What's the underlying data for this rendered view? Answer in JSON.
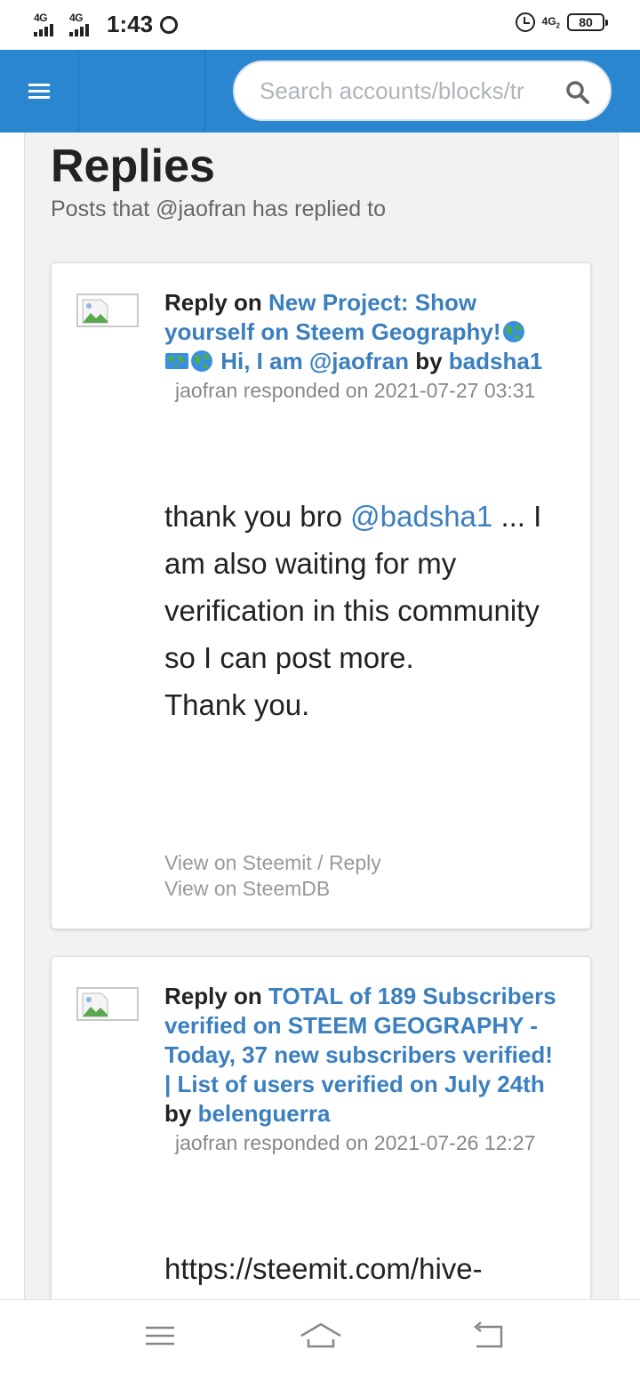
{
  "status_bar": {
    "sim1": "4G",
    "sim2": "4G",
    "time": "1:43",
    "network": "4G",
    "network_sub": "2",
    "battery": "80"
  },
  "header": {
    "search_placeholder": "Search accounts/blocks/tr"
  },
  "page": {
    "title": "Replies",
    "subtitle": "Posts that @jaofran has replied to"
  },
  "replies": [
    {
      "prefix": "Reply on",
      "post_title_part1": "New Project: Show yourself on Steem Geography!",
      "post_title_part2": "Hi, I am @jaofran",
      "by": "by",
      "author": "badsha1",
      "meta": "jaofran responded on 2021-07-27 03:31",
      "body_pre": "thank you bro",
      "mention": "@badsha1",
      "body_post": "... I am also waiting for my verification in this community so I can post more.",
      "body_line2": "Thank you.",
      "link_steemit": "View on Steemit / Reply",
      "link_steemdb": "View on SteemDB"
    },
    {
      "prefix": "Reply on",
      "post_title": "TOTAL of 189 Subscribers verified on STEEM GEOGRAPHY - Today, 37 new subscribers verified! | List of users verified on July 24th",
      "by": "by",
      "author": "belenguerra",
      "meta": "jaofran responded on 2021-07-26 12:27",
      "body": "https://steemit.com/hive-"
    }
  ],
  "icons": {
    "menu": "hamburger-icon",
    "search": "magnifier-icon",
    "globe": "globe-emoji",
    "map": "world-map-emoji",
    "broken_image": "broken-image-icon",
    "nav_menu": "recent-apps-icon",
    "nav_home": "home-icon",
    "nav_back": "back-icon"
  },
  "colors": {
    "brand": "#2a86cf",
    "link": "#3a7fbf",
    "muted": "#888888"
  }
}
